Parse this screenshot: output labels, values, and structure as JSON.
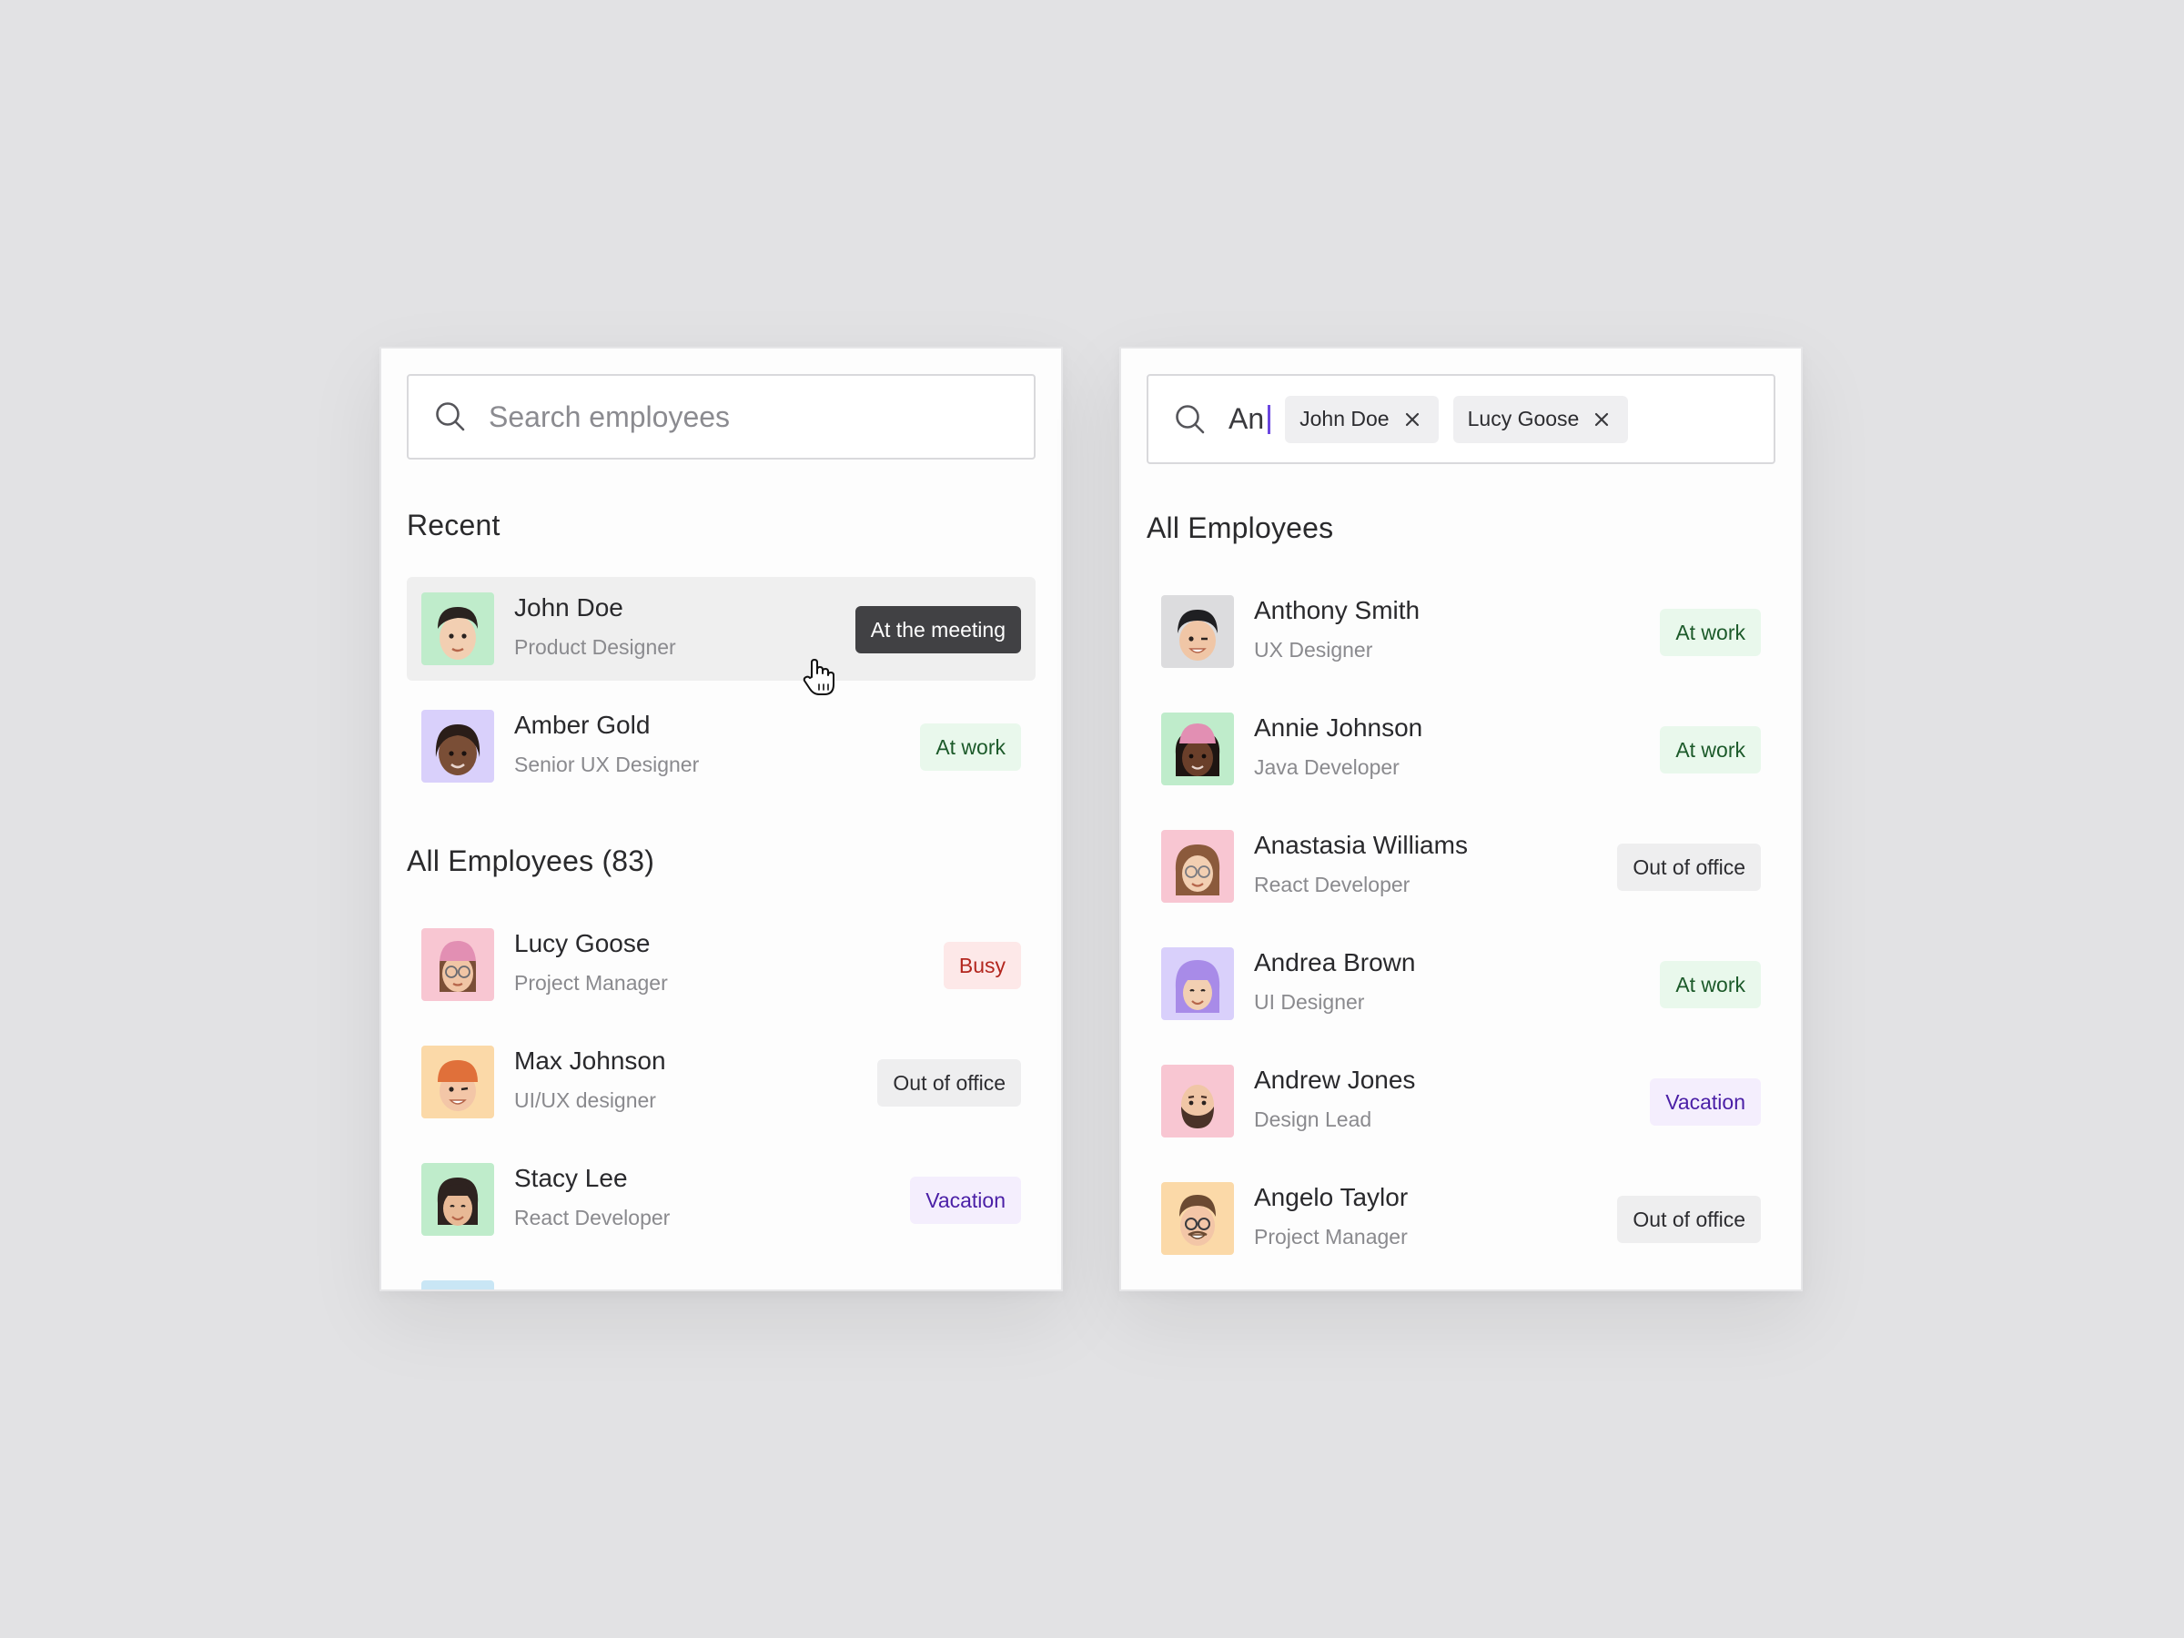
{
  "colors": {
    "at_work": "#e9f8ec",
    "out_of_office": "#eeeeef",
    "busy": "#fde8e8",
    "vacation": "#f4eefd",
    "meeting": "#414144",
    "caret": "#6b46e0"
  },
  "left": {
    "search": {
      "placeholder": "Search employees",
      "icon": "search-icon"
    },
    "recent_title": "Recent",
    "recent": [
      {
        "name": "John Doe",
        "role": "Product Designer",
        "status": "At the meeting",
        "avatar_bg": "#bfeccb"
      },
      {
        "name": "Amber Gold",
        "role": "Senior UX Designer",
        "status": "At work",
        "avatar_bg": "#d9d0fb"
      }
    ],
    "all_title": "All Employees (83)",
    "all": [
      {
        "name": "Lucy Goose",
        "role": "Project Manager",
        "status": "Busy",
        "avatar_bg": "#f8c6d2"
      },
      {
        "name": "Max Johnson",
        "role": "UI/UX designer",
        "status": "Out of office",
        "avatar_bg": "#fbd9a8"
      },
      {
        "name": "Stacy Lee",
        "role": "React Developer",
        "status": "Vacation",
        "avatar_bg": "#bfeccb"
      }
    ]
  },
  "right": {
    "search": {
      "typed": "An",
      "icon": "search-icon",
      "chips": [
        {
          "label": "John Doe",
          "icon": "close-icon"
        },
        {
          "label": "Lucy Goose",
          "icon": "close-icon"
        }
      ]
    },
    "title": "All Employees",
    "employees": [
      {
        "name": "Anthony Smith",
        "role": "UX Designer",
        "status": "At work",
        "avatar_bg": "#dcdcde"
      },
      {
        "name": "Annie Johnson",
        "role": "Java Developer",
        "status": "At work",
        "avatar_bg": "#bfeccb"
      },
      {
        "name": "Anastasia Williams",
        "role": "React Developer",
        "status": "Out of office",
        "avatar_bg": "#f8c6d2"
      },
      {
        "name": "Andrea Brown",
        "role": "UI Designer",
        "status": "At work",
        "avatar_bg": "#d9d0fb"
      },
      {
        "name": "Andrew Jones",
        "role": "Design Lead",
        "status": "Vacation",
        "avatar_bg": "#f8c6d2"
      },
      {
        "name": "Angelo Taylor",
        "role": "Project Manager",
        "status": "Out of office",
        "avatar_bg": "#fbd9a8"
      }
    ]
  }
}
